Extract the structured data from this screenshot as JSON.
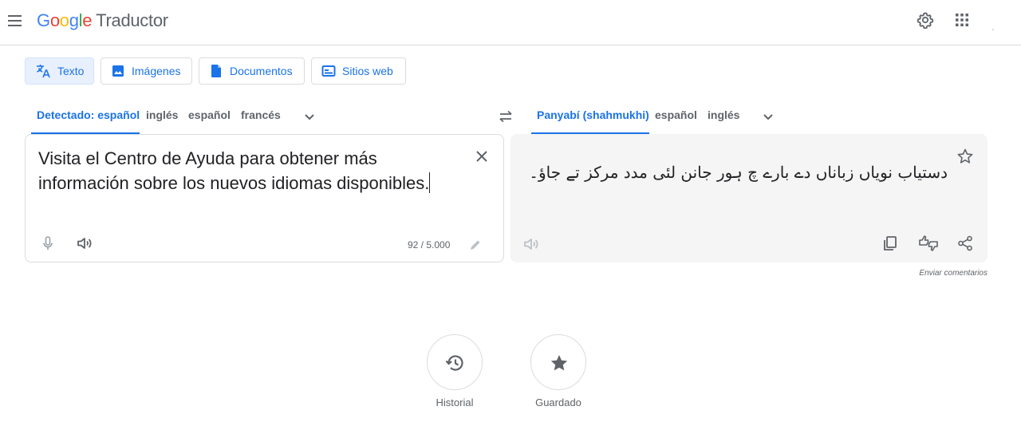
{
  "header": {
    "logo_letters": [
      "G",
      "o",
      "o",
      "g",
      "l",
      "e"
    ],
    "product": "Traductor"
  },
  "modes": [
    {
      "label": "Texto",
      "active": true,
      "icon": "translate-icon"
    },
    {
      "label": "Imágenes",
      "active": false,
      "icon": "image-icon"
    },
    {
      "label": "Documentos",
      "active": false,
      "icon": "document-icon"
    },
    {
      "label": "Sitios web",
      "active": false,
      "icon": "website-icon"
    }
  ],
  "source_langs": {
    "detected": "Detectado: español",
    "options": [
      "inglés",
      "español",
      "francés"
    ]
  },
  "target_langs": {
    "selected": "Panyabí (shahmukhi)",
    "options": [
      "español",
      "inglés"
    ]
  },
  "source": {
    "text": "Visita el Centro de Ayuda para obtener más información sobre los nuevos idiomas disponibles.",
    "char_count": "92 / 5.000"
  },
  "target": {
    "text": "دستیاب نویاں زباناں دے بارے چ ہور جانن لئی مدد مرکز تے جاؤ۔"
  },
  "feedback": "Enviar comentarios",
  "bottom": {
    "history_label": "Historial",
    "saved_label": "Guardado"
  },
  "colors": {
    "accent": "#1a73e8",
    "text": "#202124",
    "muted": "#5f6368",
    "border": "#dadce0",
    "target_bg": "#f5f5f5"
  }
}
